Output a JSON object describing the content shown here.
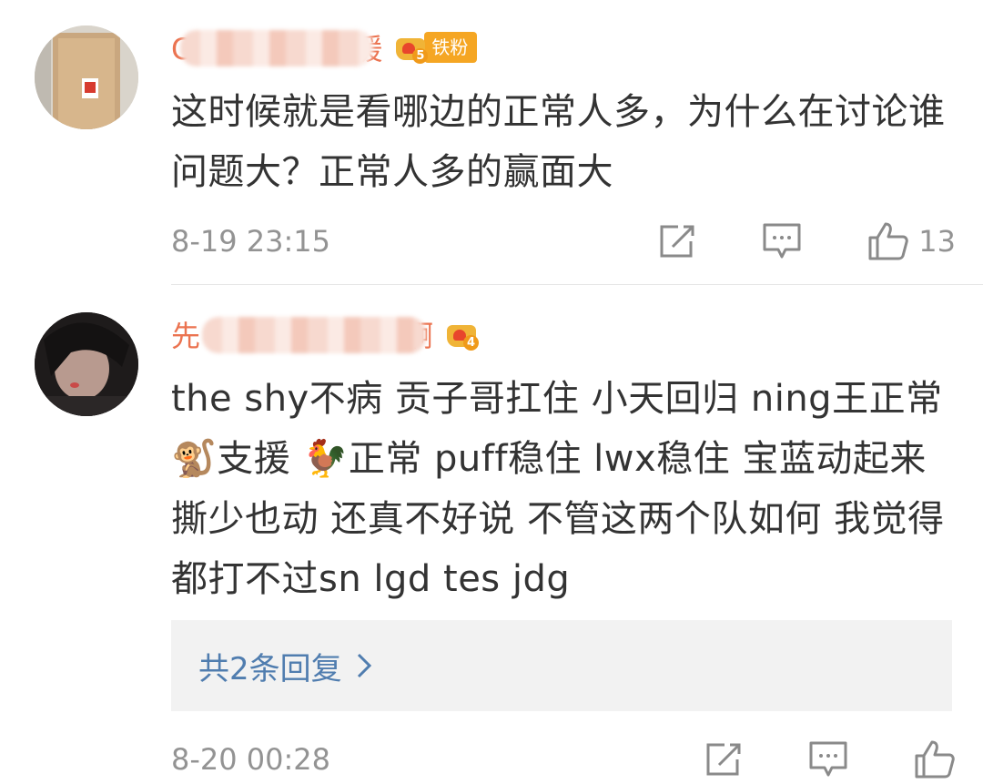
{
  "comments": [
    {
      "username_visible": "C",
      "username_tail": "媛",
      "badge_level": "5",
      "badge_label": "铁粉",
      "text": "这时候就是看哪边的正常人多，为什么在讨论谁问题大？正常人多的赢面大",
      "time": "8-19 23:15",
      "likes": "13"
    },
    {
      "username_visible": "先",
      "username_tail": "啊",
      "badge_level": "4",
      "text": "the shy不病 贡子哥扛住 小天回归 ning王正常 🐒支援 🐓正常 puff稳住 lwx稳住 宝蓝动起来 撕少也动 还真不好说 不管这两个队如何 我觉得都打不过sn lgd tes jdg",
      "replies_label": "共2条回复",
      "time": "8-20 00:28"
    }
  ],
  "icons": {
    "share": "share-icon",
    "comment": "comment-icon",
    "like": "like-icon",
    "chevron": "chevron-right-icon"
  },
  "colors": {
    "username": "#eb7350",
    "link": "#507daf",
    "meta": "#939393",
    "badge": "#f5a623"
  }
}
